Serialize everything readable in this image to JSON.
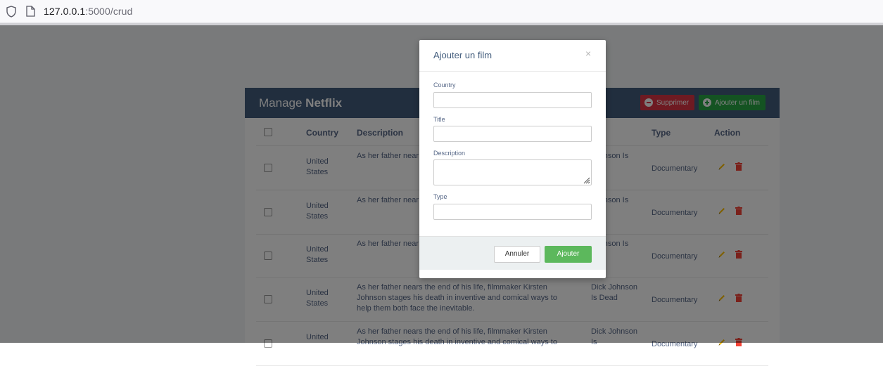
{
  "browser": {
    "url_host": "127.0.0.1",
    "url_path": ":5000/crud"
  },
  "header": {
    "title_prefix": "Manage ",
    "title_bold": "Netflix",
    "delete_label": "Supprimer",
    "add_label": "Ajouter un film"
  },
  "table": {
    "columns": [
      "Country",
      "Description",
      "e",
      "Type",
      "Action"
    ],
    "rows": [
      {
        "country": "United States",
        "description": "As her father near Johnson stages hi help them both fa",
        "title": "Johnson Is\nead",
        "type": "Documentary"
      },
      {
        "country": "United States",
        "description": "As her father near Johnson stages hi help them both fa",
        "title": "Johnson Is\nead",
        "type": "Documentary"
      },
      {
        "country": "United States",
        "description": "As her father near Johnson stages hi help them both fa",
        "title": "Johnson Is\nead",
        "type": "Documentary"
      },
      {
        "country": "United States",
        "description": "As her father nears the end of his life, filmmaker Kirsten Johnson stages his death in inventive and comical ways to help them both face the inevitable.",
        "title": "Dick Johnson Is Dead",
        "type": "Documentary"
      },
      {
        "country": "United",
        "description": "As her father nears the end of his life, filmmaker Kirsten Johnson stages his death in inventive and comical ways to",
        "title": "Dick Johnson Is",
        "type": "Documentary"
      }
    ]
  },
  "modal": {
    "title": "Ajouter un film",
    "close": "×",
    "fields": {
      "country": {
        "label": "Country",
        "value": ""
      },
      "title": {
        "label": "Title",
        "value": ""
      },
      "description": {
        "label": "Description",
        "value": ""
      },
      "type": {
        "label": "Type",
        "value": ""
      }
    },
    "cancel_label": "Annuler",
    "submit_label": "Ajouter"
  },
  "colors": {
    "header_bg": "#435d7d",
    "delete_btn": "#dc3545",
    "add_btn": "#28a745",
    "submit_btn": "#5cb85c",
    "edit_icon": "#ffc107",
    "delete_icon": "#f44336"
  }
}
